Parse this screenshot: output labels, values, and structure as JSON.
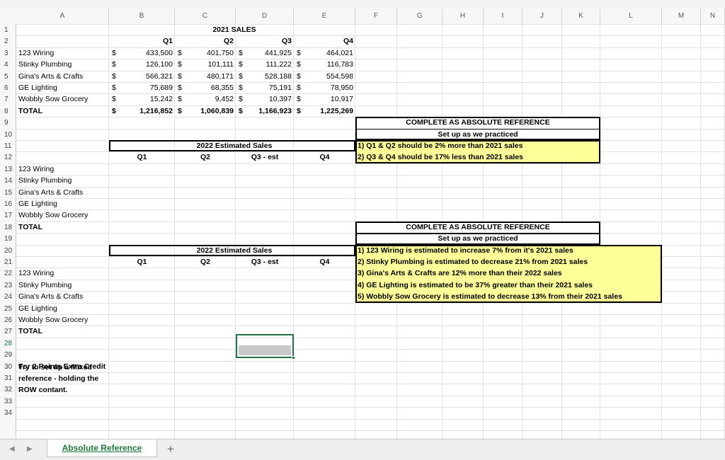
{
  "columns": [
    "A",
    "B",
    "C",
    "D",
    "E",
    "F",
    "G",
    "H",
    "I",
    "J",
    "K",
    "L",
    "M",
    "N"
  ],
  "rows": [
    "1",
    "2",
    "3",
    "4",
    "5",
    "6",
    "7",
    "8",
    "9",
    "10",
    "11",
    "12",
    "13",
    "14",
    "15",
    "16",
    "17",
    "18",
    "19",
    "20",
    "21",
    "22",
    "23",
    "24",
    "25",
    "26",
    "27",
    "28",
    "29",
    "30",
    "31",
    "32",
    "33",
    "34"
  ],
  "selected_row": "28",
  "dollar": "$",
  "table1": {
    "title": "2021 SALES",
    "quarters": [
      "Q1",
      "Q2",
      "Q3",
      "Q4"
    ],
    "rows": [
      {
        "name": "123 Wiring",
        "q1": "433,500",
        "q2": "401,750",
        "q3": "441,925",
        "q4": "464,021"
      },
      {
        "name": "Stinky Plumbing",
        "q1": "126,100",
        "q2": "101,111",
        "q3": "111,222",
        "q4": "116,783"
      },
      {
        "name": "Gina's Arts & Crafts",
        "q1": "566,321",
        "q2": "480,171",
        "q3": "528,188",
        "q4": "554,598"
      },
      {
        "name": "GE Lighting",
        "q1": "75,689",
        "q2": "68,355",
        "q3": "75,191",
        "q4": "78,950"
      },
      {
        "name": "Wobbly Sow Grocery",
        "q1": "15,242",
        "q2": "9,452",
        "q3": "10,397",
        "q4": "10,917"
      }
    ],
    "total": {
      "name": "TOTAL",
      "q1": "1,216,852",
      "q2": "1,060,839",
      "q3": "1,166,923",
      "q4": "1,225,269"
    }
  },
  "table2": {
    "title": "2022 Estimated Sales",
    "quarters": [
      "Q1",
      "Q2",
      "Q3 - est",
      "Q4"
    ],
    "rows": [
      "123 Wiring",
      "Stinky Plumbing",
      "Gina's Arts & Crafts",
      "GE Lighting",
      "Wobbly Sow Grocery"
    ],
    "total": "TOTAL"
  },
  "table3": {
    "title": "2022 Estimated Sales",
    "quarters": [
      "Q1",
      "Q2",
      "Q3 - est",
      "Q4"
    ],
    "rows": [
      "123 Wiring",
      "Stinky Plumbing",
      "Gina's Arts & Crafts",
      "GE Lighting",
      "Wobbly Sow Grocery"
    ],
    "total": "TOTAL"
  },
  "note1": {
    "heading": "COMPLETE AS ABSOLUTE REFERENCE",
    "subheading": "Set up as we practiced",
    "lines": [
      "1) Q1 & Q2 should be 2% more than 2021 sales",
      "2) Q3 & Q4 should be 17% less than 2021 sales"
    ]
  },
  "note2": {
    "heading": "COMPLETE AS ABSOLUTE REFERENCE",
    "subheading": "Set up as we practiced",
    "lines": [
      "1) 123 Wiring is estimated to increase 7% from it's 2021 sales",
      "2) Stinky Plumbing is estimated to decrease 21% from 2021 sales",
      "3) Gina's Arts & Crafts are 12% more than their 2022 sales",
      "4) GE Lighting is estimated to be 37% greater than their 2021 sales",
      "5) Wobbly Sow Grocery is estimated to decrease 13% from their 2021 sales"
    ]
  },
  "extra_credit": {
    "title": "For 2 Points Extra Credit",
    "lines": [
      "Try to set up a Mixed",
      "reference - holding the",
      "ROW contant."
    ]
  },
  "sheet_tab": "Absolute Reference",
  "add_sheet": "+",
  "nav_prev": "◀",
  "nav_next": "▶",
  "colors": {
    "note_fill": "#ffff99",
    "selection": "#217346",
    "grid": "#e1e1e1",
    "header_bg": "#f7f7f7"
  }
}
